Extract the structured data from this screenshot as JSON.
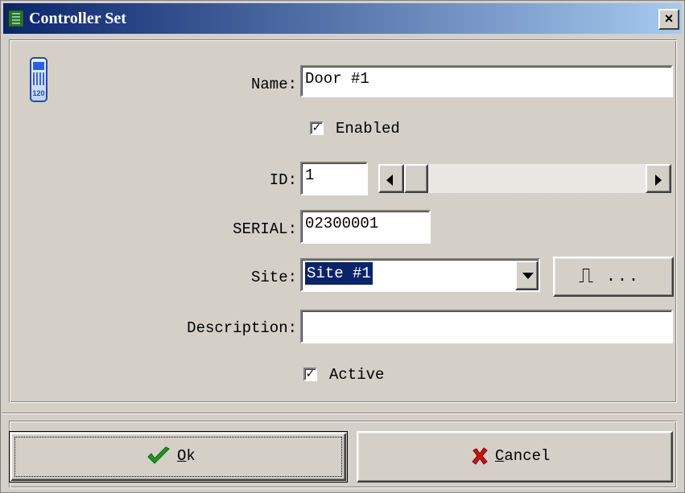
{
  "window": {
    "title": "Controller Set",
    "close_glyph": "×"
  },
  "controller_icon": {
    "name": "controller-device-icon",
    "number": "120"
  },
  "form": {
    "name_label": "Name:",
    "name_value": "Door #1",
    "enabled_label": "Enabled",
    "enabled_checked": true,
    "id_label": "ID:",
    "id_value": "1",
    "id_slider_position": 0,
    "serial_label": "SERIAL:",
    "serial_value": "02300001",
    "site_label": "Site:",
    "site_value": "Site #1",
    "site_button_glyph": "⎍",
    "site_button_dots": "...",
    "description_label": "Description:",
    "description_value": "",
    "active_label": "Active",
    "active_checked": true
  },
  "buttons": {
    "ok_label": "Ok",
    "ok_accel": "O",
    "ok_rest": "k",
    "cancel_label": "Cancel",
    "cancel_accel": "C",
    "cancel_rest": "ancel"
  },
  "colors": {
    "title_gradient_start": "#0a246a",
    "title_gradient_end": "#a6caf0",
    "face": "#d4d0c8",
    "selection": "#0a246a",
    "ok_icon": "#1f9a1f",
    "cancel_icon": "#d01010"
  },
  "icons": {
    "checkbox_mark": "check-icon",
    "ok_icon": "green-checkmark-icon",
    "cancel_icon": "red-x-icon",
    "scroll_left": "arrow-left-icon",
    "scroll_right": "arrow-right-icon",
    "dropdown": "chevron-down-icon"
  }
}
